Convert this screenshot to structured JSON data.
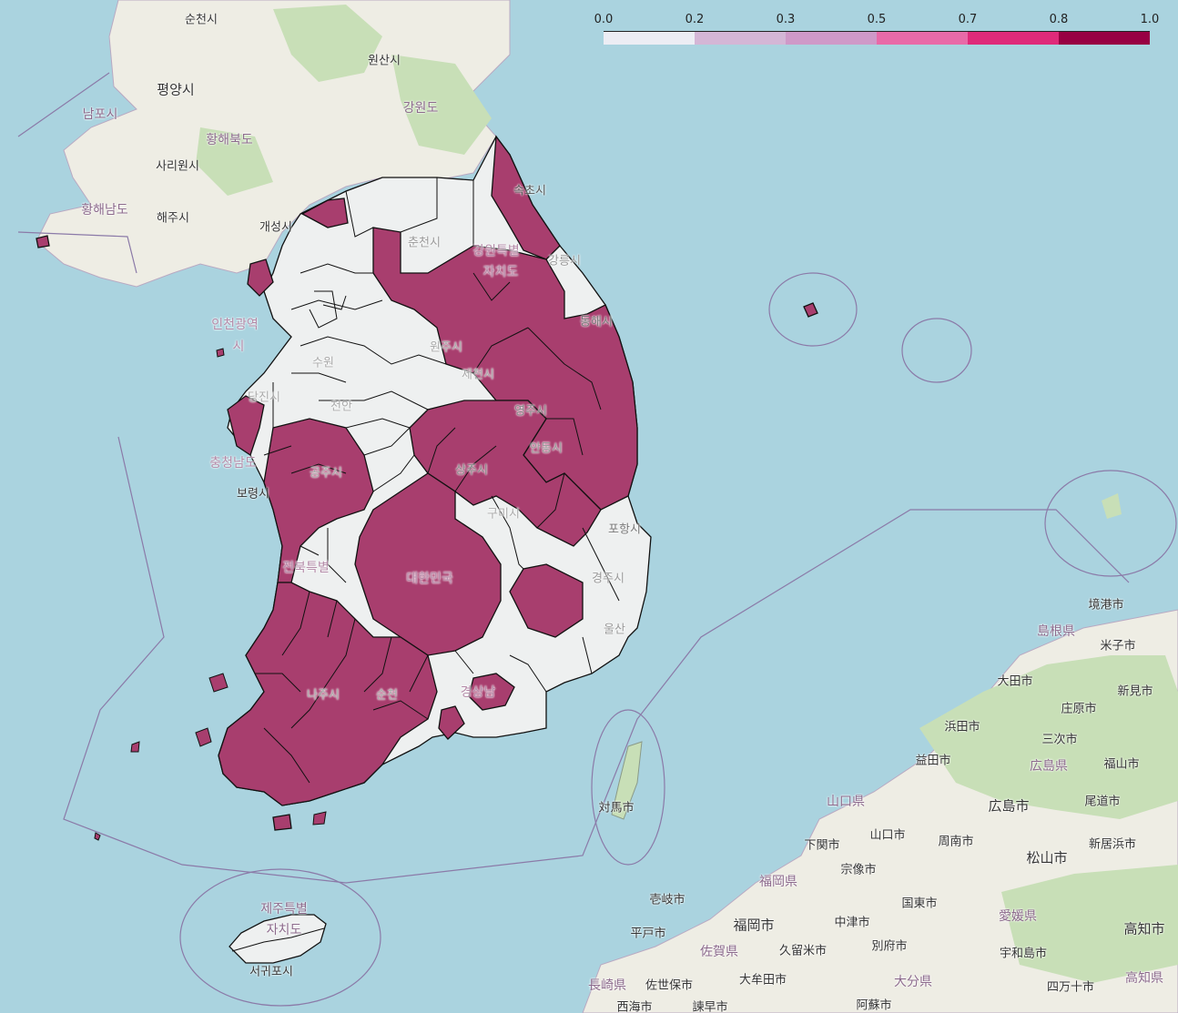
{
  "legend": {
    "ticks": [
      "0.0",
      "0.2",
      "0.3",
      "0.5",
      "0.7",
      "0.8",
      "1.0"
    ],
    "colors": [
      "#ecedf4",
      "#d4b6d6",
      "#cf99c8",
      "#e86aa8",
      "#df2a7a",
      "#980043"
    ]
  },
  "fill_high": "#a83e6e",
  "fill_low": "#eef0f0",
  "labels": {
    "suncheon": "순천시",
    "wonsan": "원산시",
    "pyongyang": "평양시",
    "gangwon_n": "강원도",
    "nampo": "남포시",
    "hwanghae_n": "황해북도",
    "sariwon": "사리원시",
    "hwanghae_s": "황해남도",
    "haeju": "해주시",
    "kaesong": "개성시",
    "sokcho": "속초시",
    "chuncheon": "춘천시",
    "gangwon_s": "강원특별",
    "jachido": "자치도",
    "gangneung": "강릉시",
    "donghae": "동해시",
    "incheon1": "인천광역",
    "incheon2": "시",
    "suwon": "수원",
    "wonju": "원주시",
    "jecheon": "제천시",
    "dangjin": "당진시",
    "cheonan": "천안",
    "yeongju": "영주시",
    "chungnam": "충청남도",
    "boryeong": "보령시",
    "sangju": "상주시",
    "andong": "안동시",
    "gongju": "공주시",
    "gumi": "구미시",
    "pohang": "포항시",
    "jeonbuk": "전북특별",
    "gyeongju": "경주시",
    "daehanminguk": "대한민국",
    "ulsan": "울산",
    "naju": "나주시",
    "suncheon_s": "순천",
    "gyeongnam": "경상남",
    "jeju1": "제주특별",
    "jeju2": "자치도",
    "seogwipo": "서귀포시",
    "tsushima": "対馬市",
    "sakaiminato": "境港市",
    "shimane": "島根県",
    "yonago": "米子市",
    "daito": "大田市",
    "niimi": "新見市",
    "shobara": "庄原市",
    "hamada": "浜田市",
    "miyoshi": "三次市",
    "masuda": "益田市",
    "hiroshima_p": "広島県",
    "fukuyama": "福山市",
    "yamaguchi_p": "山口県",
    "hiroshima_c": "広島市",
    "onomichi": "尾道市",
    "shimonoseki": "下関市",
    "yamaguchi_c": "山口市",
    "shunan": "周南市",
    "niihama": "新居浜市",
    "matsuyama": "松山市",
    "iki": "壱岐市",
    "munakata": "宗像市",
    "fukuoka_p": "福岡県",
    "kunisaki": "国東市",
    "hirado": "平戸市",
    "fukuoka_c": "福岡市",
    "nakatsu": "中津市",
    "ehime": "愛媛県",
    "kochi_c": "高知市",
    "beppu": "別府市",
    "saga": "佐賀県",
    "kurume": "久留米市",
    "uwajima": "宇和島市",
    "nagasaki": "長崎県",
    "sasebo": "佐世保市",
    "yanagawa": "大牟田市",
    "oita": "大分県",
    "shimanto": "四万十市",
    "kochi_p": "高知県",
    "saikai": "西海市",
    "isahaya": "諫早市",
    "aso": "阿蘇市"
  }
}
